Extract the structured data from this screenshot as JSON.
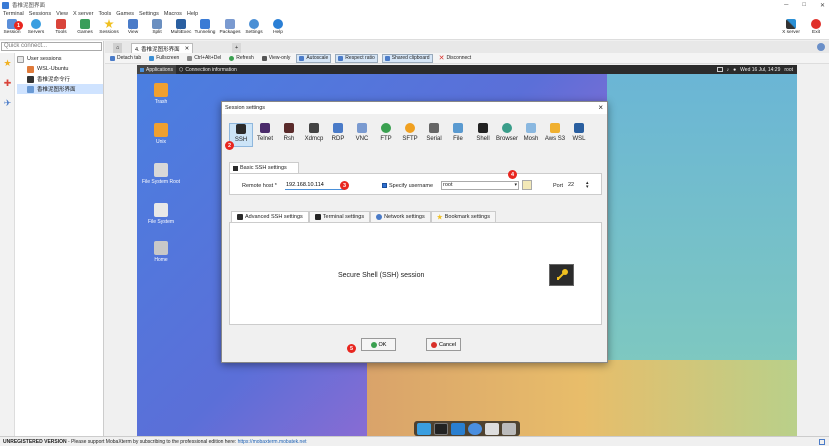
{
  "window": {
    "title": "香椎泥图界面",
    "controls": [
      "─",
      "□",
      "✕"
    ]
  },
  "menu": [
    "Terminal",
    "Sessions",
    "View",
    "X server",
    "Tools",
    "Games",
    "Settings",
    "Macros",
    "Help"
  ],
  "toolbar": {
    "session": "Session",
    "servers": "Servers",
    "tools": "Tools",
    "games": "Games",
    "sessions": "Sessions",
    "view": "View",
    "split": "Split",
    "multiexec": "MultiExec",
    "tunneling": "Tunneling",
    "packages": "Packages",
    "settings": "Settings",
    "help": "Help",
    "xserver": "X server",
    "exit": "Exit"
  },
  "left": {
    "quick_connect_placeholder": "Quick connect...",
    "tree": [
      "User sessions",
      "WSL-Ubuntu",
      "香椎泥命令行",
      "香椎泥图形界面"
    ]
  },
  "tabs": {
    "active": "4. 香椎泥图形界面"
  },
  "session_toolbar": {
    "detach": "Detach tab",
    "fullscreen": "Fullscreen",
    "ctrlaltdel": "Ctrl+Alt+Del",
    "refresh": "Refresh",
    "viewonly": "View-only",
    "autoscale": "Autoscale",
    "ratio": "Respect ratio",
    "clipboard": "Shared clipboard",
    "disconnect": "Disconnect"
  },
  "remote": {
    "applications": "Applications",
    "connection_info": "Connection information",
    "clock": "Wed 16 Jul, 14:29",
    "user": "root",
    "icons": [
      "Trash",
      "Unix",
      "File System Root",
      "File System",
      "Home"
    ]
  },
  "dialog": {
    "title": "Session settings",
    "protocols": [
      "SSH",
      "Telnet",
      "Rsh",
      "Xdmcp",
      "RDP",
      "VNC",
      "FTP",
      "SFTP",
      "Serial",
      "File",
      "Shell",
      "Browser",
      "Mosh",
      "Aws S3",
      "WSL"
    ],
    "basic_tab": "Basic SSH settings",
    "remote_host_label": "Remote host *",
    "remote_host": "192.168.10.114",
    "specify_username_label": "Specify username",
    "username": "root",
    "port_label": "Port",
    "port": "22",
    "adv_tabs": [
      "Advanced SSH settings",
      "Terminal settings",
      "Network settings",
      "Bookmark settings"
    ],
    "caption": "Secure Shell (SSH) session",
    "ok": "OK",
    "cancel": "Cancel"
  },
  "markers": [
    "1",
    "2",
    "3",
    "4",
    "5"
  ],
  "status": {
    "unregistered": "UNREGISTERED VERSION",
    "text": "  -  Please support MobaXterm by subscribing to the professional edition here: ",
    "link": "https://mobaxterm.mobatek.net"
  },
  "colors": {
    "accent": "#4a90d9",
    "marker_red": "#e8261f",
    "selected_proto": "#cce4f7"
  }
}
